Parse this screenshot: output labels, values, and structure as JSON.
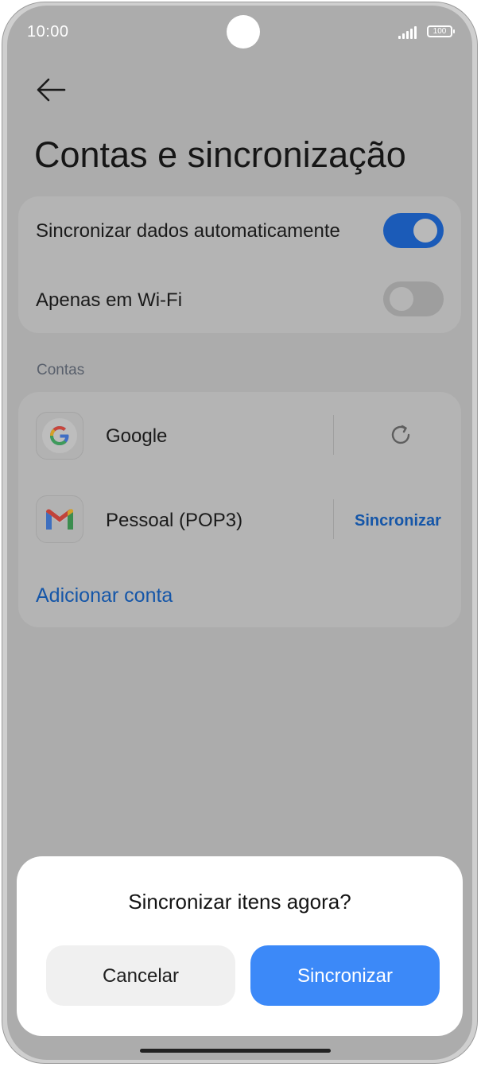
{
  "status_bar": {
    "time": "10:00",
    "battery": "100"
  },
  "header": {
    "title": "Contas e sincronização"
  },
  "settings": {
    "auto_sync": {
      "label": "Sincronizar dados automaticamente",
      "enabled": true
    },
    "wifi_only": {
      "label": "Apenas em Wi-Fi",
      "enabled": false
    }
  },
  "accounts": {
    "section_label": "Contas",
    "items": [
      {
        "name": "Google",
        "icon": "google-icon",
        "action": "sync-icon"
      },
      {
        "name": "Pessoal (POP3)",
        "icon": "gmail-icon",
        "action_label": "Sincronizar"
      }
    ],
    "add_account": "Adicionar conta"
  },
  "dialog": {
    "title": "Sincronizar itens agora?",
    "cancel": "Cancelar",
    "confirm": "Sincronizar"
  },
  "colors": {
    "accent": "#3c89f8",
    "link": "#1556a8",
    "toggle_on": "#1b5bb8"
  }
}
